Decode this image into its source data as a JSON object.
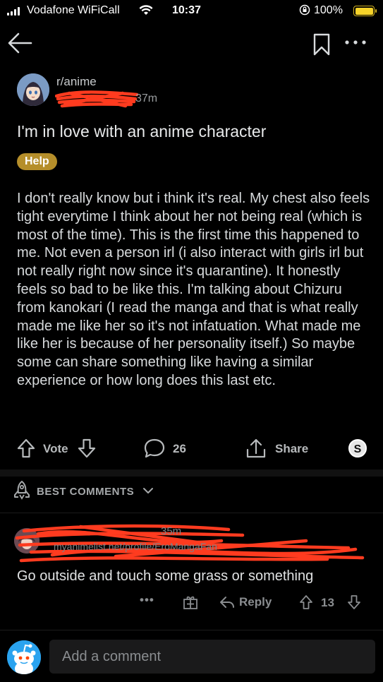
{
  "status_bar": {
    "carrier": "Vodafone WiFiCall",
    "time": "10:37",
    "battery_percent": "100%"
  },
  "nav": {
    "back_icon": "arrow-left-icon",
    "bookmark_icon": "bookmark-icon",
    "more_icon": "more-horizontal-icon"
  },
  "post": {
    "subreddit": "r/anime",
    "age": "37m",
    "title": "I'm in love with an anime character",
    "flair": "Help",
    "body": "I don't really know but i think it's real. My chest also feels tight everytime I think about her not being real (which is most of the time). This is the first time this happened to me. Not even a person irl (i also interact with girls irl but not really right now since it's quarantine). It honestly feels so bad to be like this. I'm talking about Chizuru from kanokari (I read the manga and that is what really made me like her so it's not infatuation. What made me like her is because of her personality itself.) So maybe some can share something like having a similar experience or how long does this last etc.",
    "vote_label": "Vote",
    "comment_count": "26",
    "share_label": "Share",
    "award_label": "S"
  },
  "comments": {
    "sort_label": "BEST COMMENTS",
    "items": [
      {
        "age": "35m",
        "flair_link": "myanimelist.net/profile/EroMangaFan",
        "body": "Go outside and touch some grass or something",
        "more": "•••",
        "reply_label": "Reply",
        "score": "13"
      }
    ]
  },
  "composer": {
    "placeholder": "Add a comment"
  },
  "colors": {
    "background": "#000000",
    "flair": "#b58e2a",
    "redaction": "#ff3b1f",
    "battery": "#f6d32a",
    "snoo": "#2aa3ef"
  }
}
